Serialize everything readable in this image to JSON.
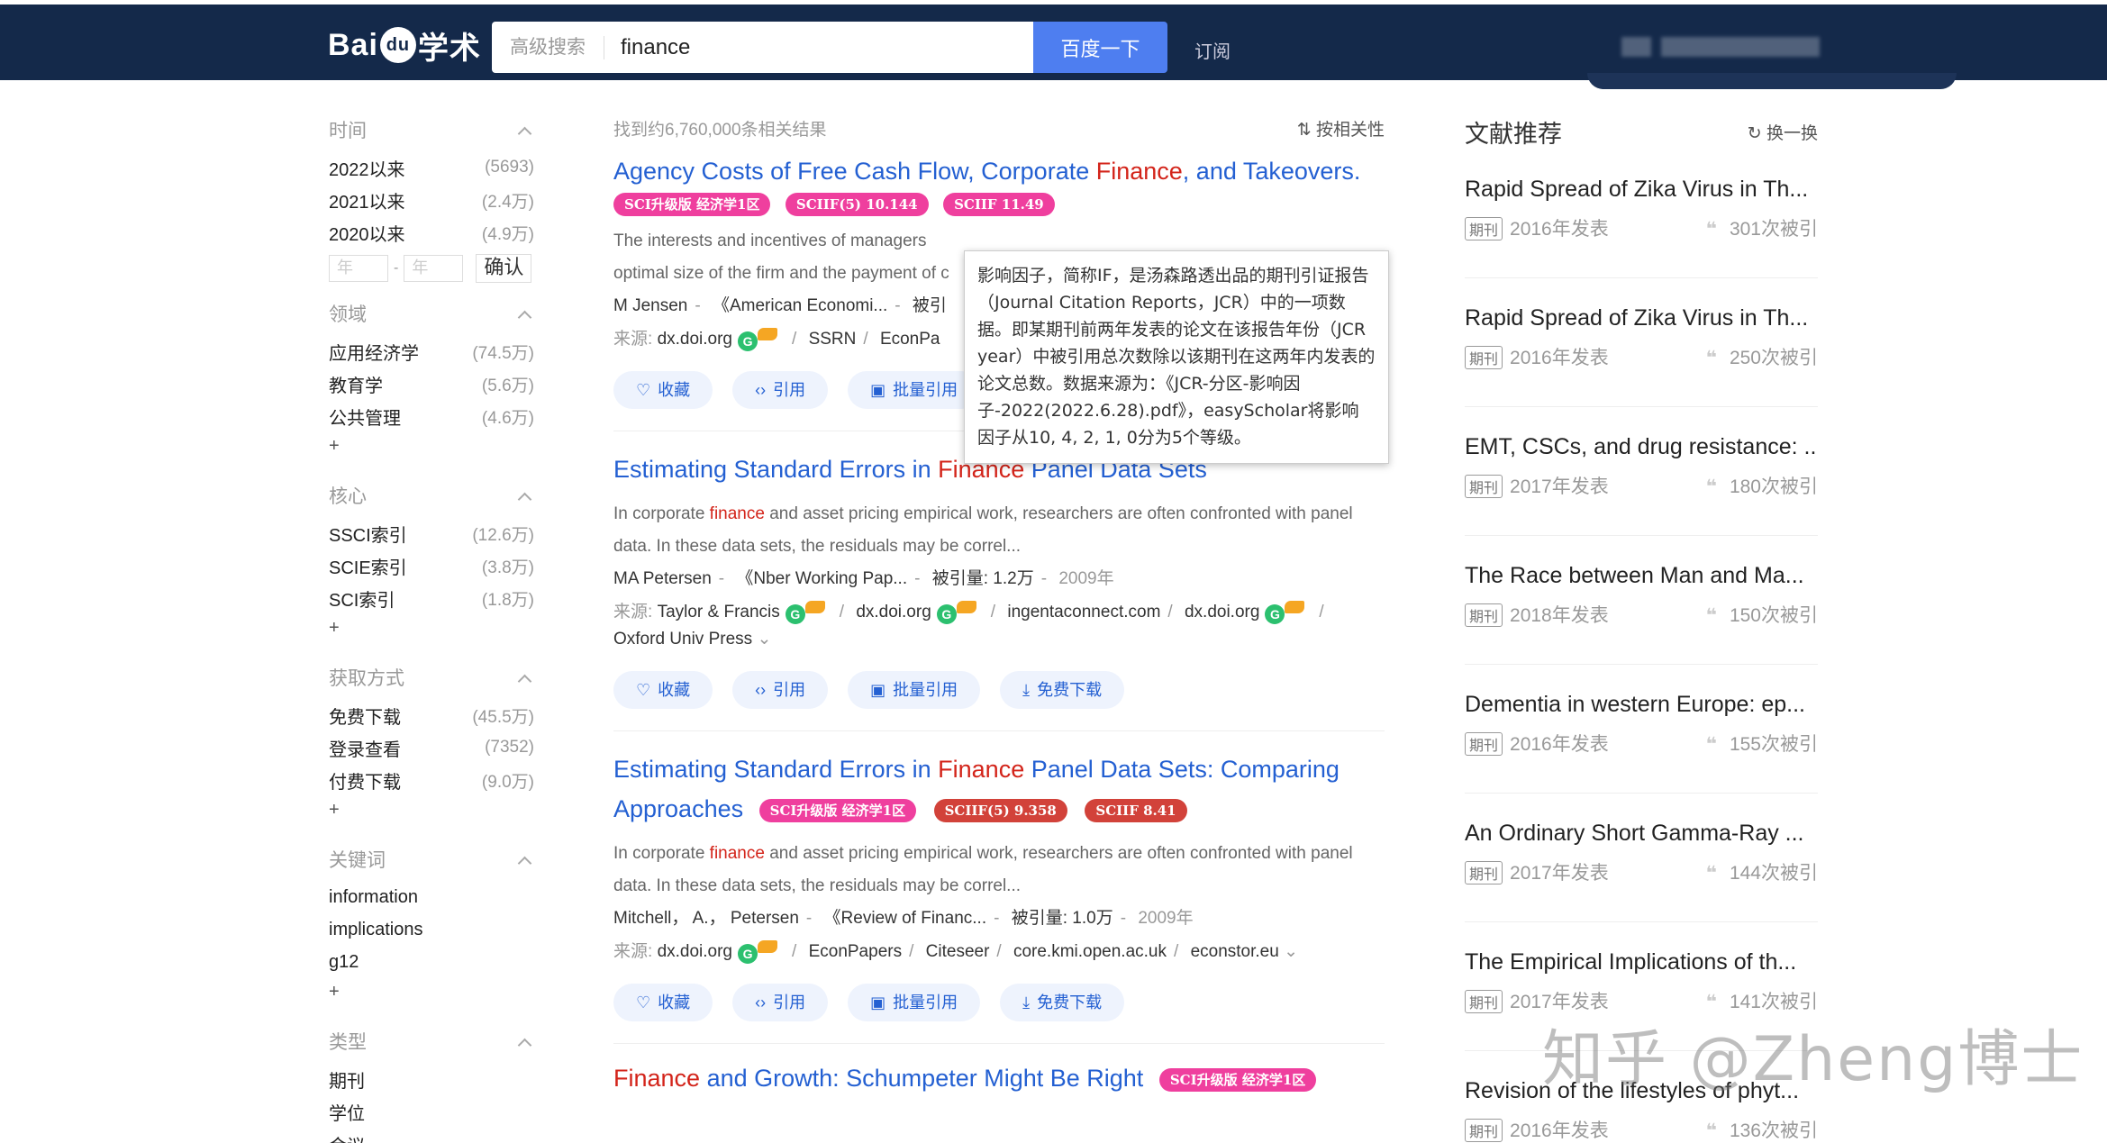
{
  "header": {
    "logo_text": "Bai",
    "logo_paw": "du",
    "logo_suffix": "学术",
    "advanced_search": "高级搜索",
    "query": "finance",
    "search_button": "百度一下",
    "subscribe": "订阅"
  },
  "sidebar": {
    "time": {
      "title": "时间",
      "items": [
        {
          "label": "2022以来",
          "count": "(5693)"
        },
        {
          "label": "2021以来",
          "count": "(2.4万)"
        },
        {
          "label": "2020以来",
          "count": "(4.9万)"
        }
      ],
      "year_from_placeholder": "年",
      "year_to_placeholder": "年",
      "confirm": "确认"
    },
    "field": {
      "title": "领域",
      "items": [
        {
          "label": "应用经济学",
          "count": "(74.5万)"
        },
        {
          "label": "教育学",
          "count": "(5.6万)"
        },
        {
          "label": "公共管理",
          "count": "(4.6万)"
        }
      ],
      "more": "+"
    },
    "core": {
      "title": "核心",
      "items": [
        {
          "label": "SSCI索引",
          "count": "(12.6万)"
        },
        {
          "label": "SCIE索引",
          "count": "(3.8万)"
        },
        {
          "label": "SCI索引",
          "count": "(1.8万)"
        }
      ],
      "more": "+"
    },
    "access": {
      "title": "获取方式",
      "items": [
        {
          "label": "免费下载",
          "count": "(45.5万)"
        },
        {
          "label": "登录查看",
          "count": "(7352)"
        },
        {
          "label": "付费下载",
          "count": "(9.0万)"
        }
      ],
      "more": "+"
    },
    "keywords": {
      "title": "关键词",
      "items": [
        "information",
        "implications",
        "g12"
      ],
      "more": "+"
    },
    "type": {
      "title": "类型",
      "items": [
        "期刊",
        "学位",
        "会议"
      ]
    }
  },
  "results": {
    "count_text": "找到约6,760,000条相关结果",
    "sort_label": "按相关性",
    "items": [
      {
        "title_a": "Agency Costs of Free Cash Flow, Corporate ",
        "title_hl": "Finance",
        "title_b": ", and Takeovers.",
        "badges": [
          "SCI升级版 经济学1区",
          "SCIIF(5) 10.144",
          "SCIIF 11.49"
        ],
        "abstract_line1": "The interests and incentives of managers",
        "abstract_line2": "optimal size of the firm and the payment of c",
        "author": "M Jensen",
        "journal": "《American Economi...",
        "cited_prefix": "被引",
        "source_label": "来源:",
        "sources": [
          "dx.doi.org",
          "SSRN",
          "EconPa"
        ],
        "actions": [
          "收藏",
          "引用",
          "批量引用"
        ]
      },
      {
        "title_a": "Estimating Standard Errors in ",
        "title_hl": "Finance",
        "title_b": " Panel Data Sets",
        "abstract_a": "In corporate ",
        "abstract_hl": "finance",
        "abstract_b": " and asset pricing empirical work, researchers are often confronted with panel data. In these data sets, the residuals may be correl...",
        "author": "MA Petersen",
        "journal": "《Nber Working Pap...",
        "cited": "被引量: 1.2万",
        "year": "2009年",
        "source_label": "来源:",
        "sources": [
          "Taylor & Francis",
          "dx.doi.org",
          "ingentaconnect.com",
          "dx.doi.org",
          "Oxford Univ Press"
        ],
        "actions": [
          "收藏",
          "引用",
          "批量引用",
          "免费下载"
        ]
      },
      {
        "title_a": "Estimating Standard Errors in ",
        "title_hl": "Finance",
        "title_b": " Panel Data Sets: Comparing Approaches",
        "badges": [
          "SCI升级版 经济学1区",
          "SCIIF(5) 9.358",
          "SCIIF 8.41"
        ],
        "abstract_a": "In corporate ",
        "abstract_hl": "finance",
        "abstract_b": " and asset pricing empirical work, researchers are often confronted with panel data. In these data sets, the residuals may be correl...",
        "author": "Mitchell， A.， Petersen",
        "journal": "《Review of Financ...",
        "cited": "被引量: 1.0万",
        "year": "2009年",
        "source_label": "来源:",
        "sources": [
          "dx.doi.org",
          "EconPapers",
          "Citeseer",
          "core.kmi.open.ac.uk",
          "econstor.eu"
        ],
        "actions": [
          "收藏",
          "引用",
          "批量引用",
          "免费下载"
        ]
      },
      {
        "title_hl": "Finance",
        "title_b": " and Growth: Schumpeter Might Be Right",
        "badges": [
          "SCI升级版 经济学1区"
        ]
      }
    ]
  },
  "tooltip": {
    "text": "影响因子，简称IF，是汤森路透出品的期刊引证报告（Journal Citation Reports，JCR）中的一项数据。即某期刊前两年发表的论文在该报告年份（JCR year）中被引用总次数除以该期刊在这两年内发表的论文总数。数据来源为：《JCR-分区-影响因子-2022(2022.6.28).pdf》，easyScholar将影响因子从10, 4, 2, 1, 0分为5个等级。"
  },
  "recommend": {
    "title": "文献推荐",
    "refresh": "换一换",
    "items": [
      {
        "title": "Rapid Spread of Zika Virus in Th...",
        "tag": "期刊",
        "year": "2016年发表",
        "cited": "301次被引"
      },
      {
        "title": "Rapid Spread of Zika Virus in Th...",
        "tag": "期刊",
        "year": "2016年发表",
        "cited": "250次被引"
      },
      {
        "title": "EMT, CSCs, and drug resistance: ...",
        "tag": "期刊",
        "year": "2017年发表",
        "cited": "180次被引"
      },
      {
        "title": "The Race between Man and Ma...",
        "tag": "期刊",
        "year": "2018年发表",
        "cited": "150次被引"
      },
      {
        "title": "Dementia in western Europe: ep...",
        "tag": "期刊",
        "year": "2016年发表",
        "cited": "155次被引"
      },
      {
        "title": "An Ordinary Short Gamma-Ray ...",
        "tag": "期刊",
        "year": "2017年发表",
        "cited": "144次被引"
      },
      {
        "title": "The Empirical Implications of th...",
        "tag": "期刊",
        "year": "2017年发表",
        "cited": "141次被引"
      },
      {
        "title": "Revision of the lifestyles of phyt...",
        "tag": "期刊",
        "year": "2016年发表",
        "cited": "136次被引"
      }
    ]
  },
  "watermark": "知乎 @Zheng博士"
}
